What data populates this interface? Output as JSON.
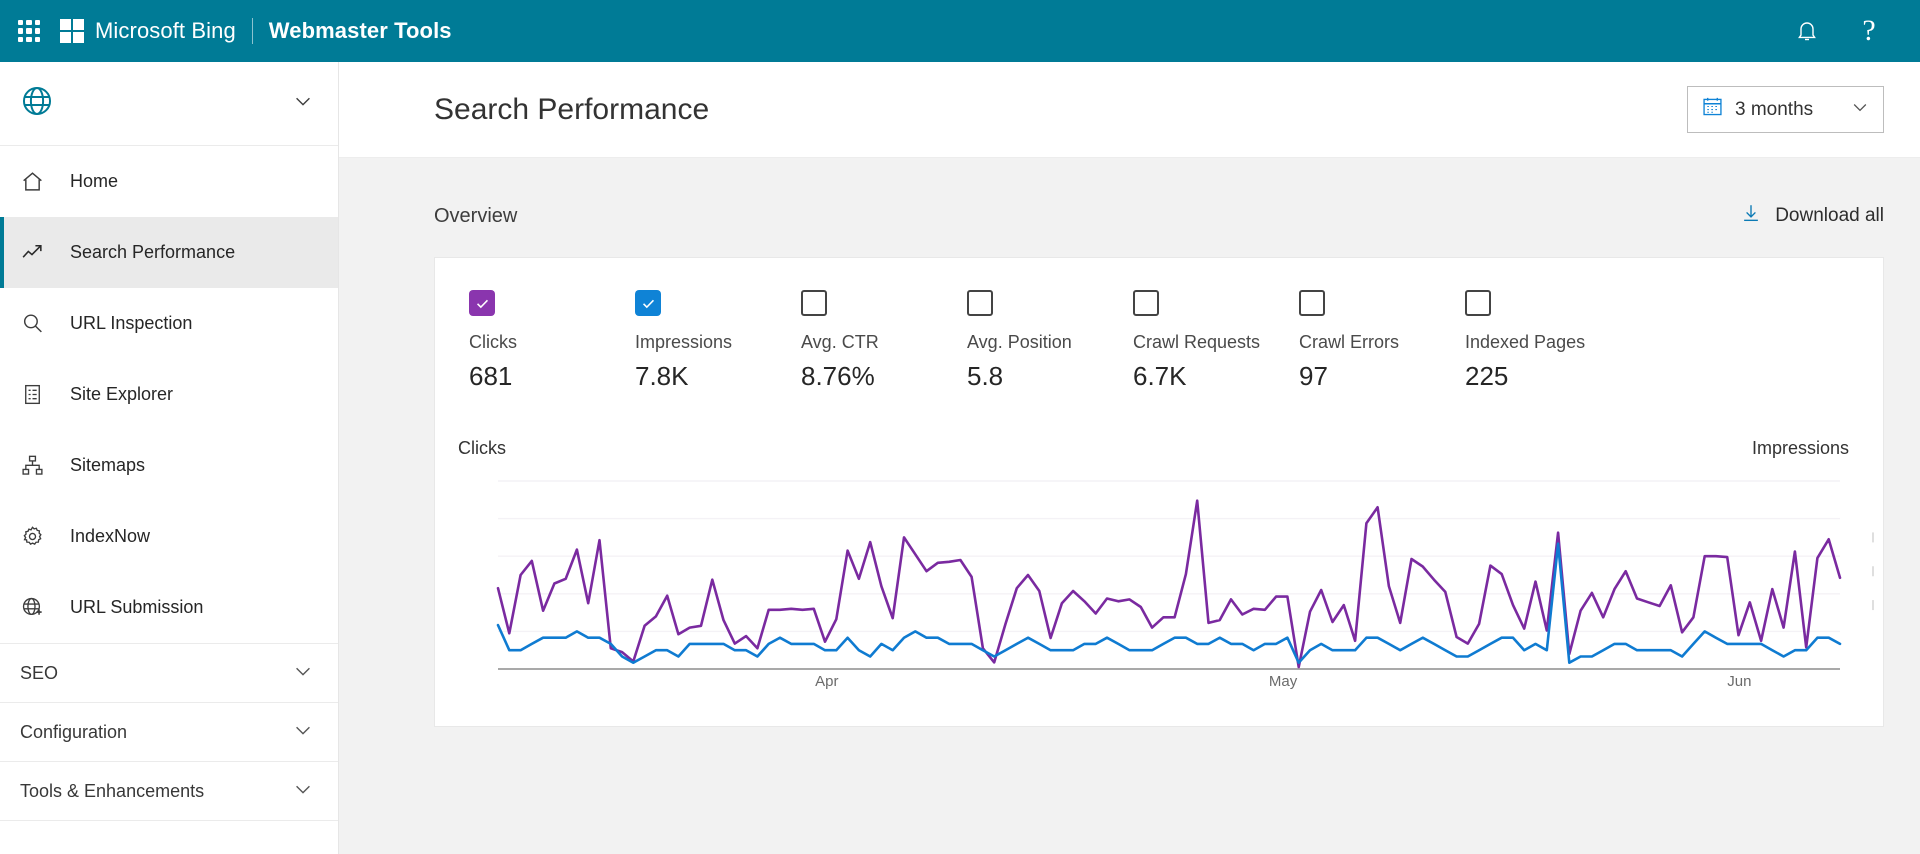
{
  "topbar": {
    "waffle_icon": "app-launcher-icon",
    "logo_icon": "microsoft-logo-icon",
    "brand": "Microsoft Bing",
    "product": "Webmaster Tools",
    "notifications_icon": "bell-icon",
    "help_icon": "question-mark-icon",
    "bg_color": "#007b96"
  },
  "sidebar": {
    "site_selector": {
      "icon": "globe-icon",
      "chevron": "chevron-down-icon"
    },
    "items": [
      {
        "label": "Home",
        "icon": "home-icon",
        "active": false
      },
      {
        "label": "Search Performance",
        "icon": "trending-up-icon",
        "active": true
      },
      {
        "label": "URL Inspection",
        "icon": "magnifier-icon",
        "active": false
      },
      {
        "label": "Site Explorer",
        "icon": "document-list-icon",
        "active": false
      },
      {
        "label": "Sitemaps",
        "icon": "sitemap-hierarchy-icon",
        "active": false
      },
      {
        "label": "IndexNow",
        "icon": "gear-icon",
        "active": false
      },
      {
        "label": "URL Submission",
        "icon": "globe-plus-icon",
        "active": false
      }
    ],
    "groups": [
      {
        "label": "SEO",
        "chevron": "chevron-down-icon"
      },
      {
        "label": "Configuration",
        "chevron": "chevron-down-icon"
      },
      {
        "label": "Tools & Enhancements",
        "chevron": "chevron-down-icon"
      }
    ],
    "accent_color": "#007b96"
  },
  "page": {
    "title": "Search Performance",
    "date_range": {
      "value": "3 months",
      "icon": "calendar-icon",
      "chevron": "chevron-down-icon"
    },
    "overview_label": "Overview",
    "download": {
      "label": "Download all",
      "icon": "download-icon"
    }
  },
  "metrics": [
    {
      "name": "Clicks",
      "value": "681",
      "checked": true,
      "color": "#8a35ae"
    },
    {
      "name": "Impressions",
      "value": "7.8K",
      "checked": true,
      "color": "#0f83d6"
    },
    {
      "name": "Avg. CTR",
      "value": "8.76%",
      "checked": false,
      "color": ""
    },
    {
      "name": "Avg. Position",
      "value": "5.8",
      "checked": false,
      "color": ""
    },
    {
      "name": "Crawl Requests",
      "value": "6.7K",
      "checked": false,
      "color": ""
    },
    {
      "name": "Crawl Errors",
      "value": "97",
      "checked": false,
      "color": ""
    },
    {
      "name": "Indexed Pages",
      "value": "225",
      "checked": false,
      "color": ""
    }
  ],
  "chart_data": {
    "type": "line",
    "title": "",
    "left_axis_label": "Clicks",
    "right_axis_label": "Impressions",
    "xlabel": "",
    "ylabel": "",
    "grid": true,
    "legend_position": "top",
    "tick_labels": [
      "Apr",
      "May",
      "Jun"
    ],
    "tick_positions": [
      0.245,
      0.585,
      0.925
    ],
    "series": [
      {
        "name": "Impressions",
        "color": "#7a2aa0",
        "axis": "right",
        "ylim": [
          0,
          200
        ],
        "values": [
          86,
          38,
          100,
          115,
          62,
          91,
          96,
          127,
          70,
          137,
          22,
          18,
          8,
          46,
          56,
          78,
          37,
          44,
          46,
          95,
          52,
          27,
          35,
          22,
          63,
          63,
          64,
          63,
          64,
          29,
          53,
          126,
          96,
          135,
          88,
          54,
          140,
          122,
          104,
          113,
          114,
          116,
          98,
          22,
          7,
          48,
          86,
          100,
          83,
          33,
          70,
          83,
          72,
          59,
          75,
          72,
          74,
          66,
          44,
          55,
          55,
          101,
          179,
          49,
          52,
          74,
          58,
          64,
          63,
          77,
          77,
          2,
          61,
          84,
          50,
          68,
          30,
          155,
          172,
          88,
          49,
          117,
          109,
          95,
          82,
          34,
          27,
          48,
          110,
          101,
          68,
          43,
          93,
          41,
          145,
          16,
          62,
          81,
          55,
          85,
          104,
          75,
          71,
          67,
          89,
          39,
          55,
          120,
          120,
          119,
          36,
          71,
          30,
          85,
          44,
          125,
          23,
          118,
          138,
          97
        ]
      },
      {
        "name": "Clicks",
        "color": "#0f7bd1",
        "axis": "left",
        "ylim": [
          0,
          30
        ],
        "values": [
          7,
          3,
          3,
          4,
          5,
          5,
          5,
          6,
          5,
          5,
          4,
          2,
          1,
          2,
          3,
          3,
          2,
          4,
          4,
          4,
          4,
          3,
          3,
          2,
          4,
          5,
          4,
          4,
          4,
          3,
          3,
          5,
          3,
          2,
          4,
          3,
          5,
          6,
          5,
          5,
          4,
          4,
          4,
          3,
          2,
          3,
          4,
          5,
          4,
          3,
          3,
          3,
          4,
          4,
          5,
          4,
          3,
          3,
          3,
          4,
          5,
          5,
          4,
          4,
          5,
          4,
          4,
          3,
          4,
          4,
          5,
          1,
          3,
          4,
          3,
          3,
          3,
          5,
          5,
          4,
          3,
          4,
          5,
          4,
          3,
          2,
          2,
          3,
          4,
          5,
          5,
          3,
          4,
          3,
          20,
          1,
          2,
          2,
          3,
          4,
          4,
          3,
          3,
          3,
          3,
          2,
          4,
          6,
          5,
          4,
          4,
          4,
          4,
          3,
          2,
          3,
          3,
          5,
          5,
          4
        ]
      }
    ]
  }
}
